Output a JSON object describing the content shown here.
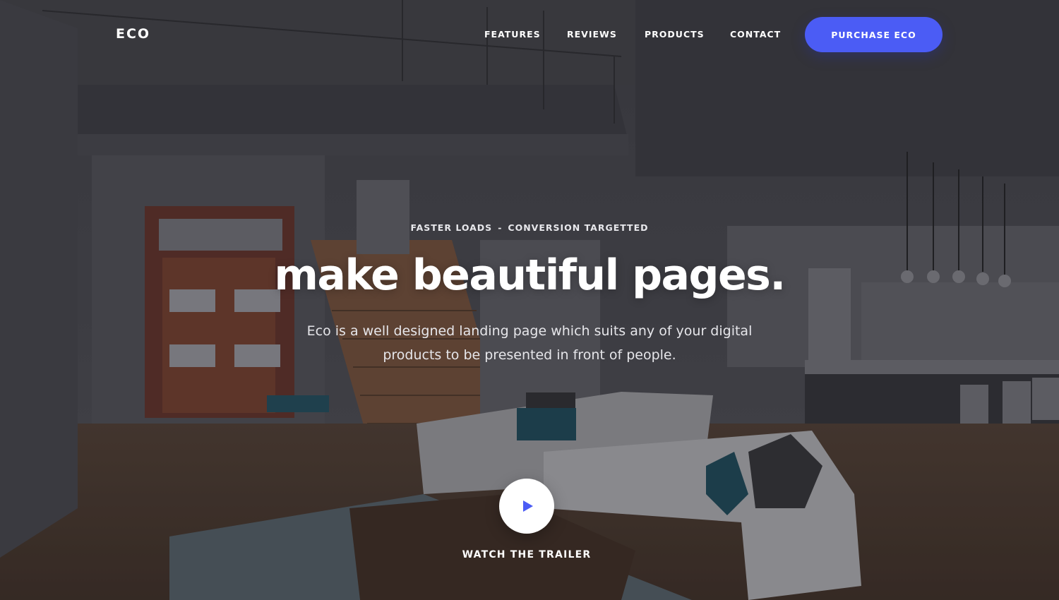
{
  "brand": {
    "name": "ECO"
  },
  "nav": {
    "links": [
      {
        "label": "FEATURES"
      },
      {
        "label": "REVIEWS"
      },
      {
        "label": "PRODUCTS"
      },
      {
        "label": "CONTACT"
      }
    ],
    "cta_label": "PURCHASE ECO"
  },
  "hero": {
    "kicker": {
      "left": "FASTER LOADS",
      "separator": "-",
      "right": "CONVERSION TARGETTED"
    },
    "headline": "make beautiful pages.",
    "subtitle": "Eco is a well designed landing page which suits any of your digital products to be presented in front of people.",
    "trailer_label": "WATCH THE TRAILER",
    "background_image": "dark-tinted living room interior with staircase, wooden door, sofa and kitchen island"
  },
  "colors": {
    "accent": "#4b5cf5",
    "text": "#ffffff",
    "overlay": "#2a2a30"
  },
  "icons": {
    "play": "play-icon"
  }
}
